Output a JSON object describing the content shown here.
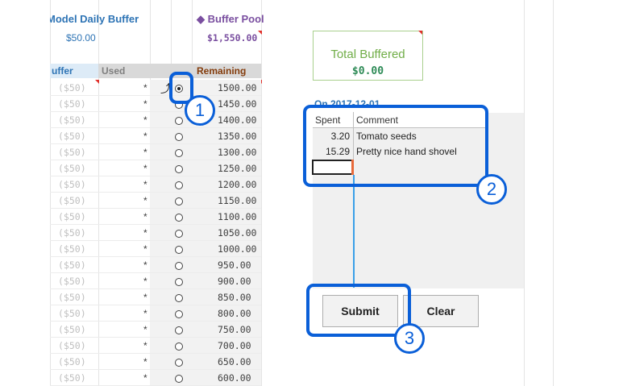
{
  "sheet": {
    "model_daily_buffer_label": "Model Daily Buffer",
    "model_daily_buffer_value": "$50.00",
    "buffer_pool_label": "◆ Buffer Pool",
    "buffer_pool_value": "$1,550.00",
    "columns": {
      "buffer": "uffer",
      "used": "Used",
      "remaining": "Remaining"
    },
    "rows": [
      {
        "buffer": "($50)",
        "used": "*",
        "remaining": "1500.00",
        "selected": true
      },
      {
        "buffer": "($50)",
        "used": "*",
        "remaining": "1450.00"
      },
      {
        "buffer": "($50)",
        "used": "*",
        "remaining": "1400.00"
      },
      {
        "buffer": "($50)",
        "used": "*",
        "remaining": "1350.00"
      },
      {
        "buffer": "($50)",
        "used": "*",
        "remaining": "1300.00"
      },
      {
        "buffer": "($50)",
        "used": "*",
        "remaining": "1250.00"
      },
      {
        "buffer": "($50)",
        "used": "*",
        "remaining": "1200.00"
      },
      {
        "buffer": "($50)",
        "used": "*",
        "remaining": "1150.00"
      },
      {
        "buffer": "($50)",
        "used": "*",
        "remaining": "1100.00"
      },
      {
        "buffer": "($50)",
        "used": "*",
        "remaining": "1050.00"
      },
      {
        "buffer": "($50)",
        "used": "*",
        "remaining": "1000.00"
      },
      {
        "buffer": "($50)",
        "used": "*",
        "remaining": "950.00"
      },
      {
        "buffer": "($50)",
        "used": "*",
        "remaining": "900.00"
      },
      {
        "buffer": "($50)",
        "used": "*",
        "remaining": "850.00"
      },
      {
        "buffer": "($50)",
        "used": "*",
        "remaining": "800.00"
      },
      {
        "buffer": "($50)",
        "used": "*",
        "remaining": "750.00"
      },
      {
        "buffer": "($50)",
        "used": "*",
        "remaining": "700.00"
      },
      {
        "buffer": "($50)",
        "used": "*",
        "remaining": "650.00"
      },
      {
        "buffer": "($50)",
        "used": "*",
        "remaining": "600.00"
      }
    ]
  },
  "total": {
    "label": "Total Buffered",
    "value": "$0.00"
  },
  "entry": {
    "date_label": "On 2017-12-01",
    "spent_header": "Spent",
    "comment_header": "Comment",
    "items": [
      {
        "spent": "3.20",
        "comment": "Tomato seeds"
      },
      {
        "spent": "15.29",
        "comment": "Pretty nice hand shovel"
      }
    ]
  },
  "buttons": {
    "submit": "Submit",
    "clear": "Clear"
  },
  "callouts": [
    "1",
    "2",
    "3"
  ],
  "colors": {
    "callout": "#0a5fd8",
    "connector": "#3aa0e8",
    "buffer_pool": "#7a4fa0",
    "daily_buffer": "#2e74b5"
  }
}
